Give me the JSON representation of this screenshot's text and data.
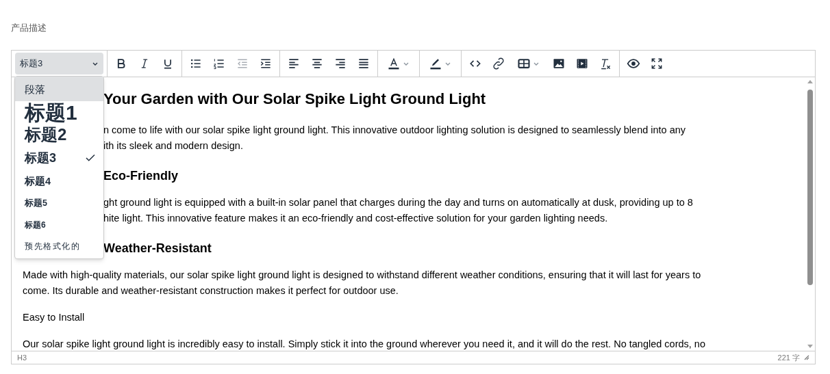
{
  "field_label": "产品描述",
  "toolbar": {
    "block_select": {
      "value": "标题3",
      "expanded": true
    },
    "groups": [
      [
        {
          "kind": "bold",
          "disabled": false
        },
        {
          "kind": "italic",
          "disabled": false
        },
        {
          "kind": "underline",
          "disabled": false
        }
      ],
      [
        {
          "kind": "bullet-list",
          "disabled": false
        },
        {
          "kind": "number-list",
          "disabled": false
        },
        {
          "kind": "outdent",
          "disabled": true
        },
        {
          "kind": "indent",
          "disabled": false
        }
      ],
      [
        {
          "kind": "align-left",
          "disabled": false
        },
        {
          "kind": "align-center",
          "disabled": false
        },
        {
          "kind": "align-right",
          "disabled": false
        },
        {
          "kind": "justify",
          "disabled": false
        }
      ],
      [
        {
          "kind": "text-color",
          "disabled": false
        }
      ],
      [
        {
          "kind": "highlight",
          "disabled": false
        }
      ],
      [
        {
          "kind": "code",
          "disabled": false
        },
        {
          "kind": "link",
          "disabled": false
        },
        {
          "kind": "table",
          "disabled": false
        },
        {
          "kind": "image",
          "disabled": false
        },
        {
          "kind": "media",
          "disabled": false
        },
        {
          "kind": "clear-format",
          "disabled": false
        }
      ],
      [
        {
          "kind": "preview",
          "disabled": false
        },
        {
          "kind": "fullscreen",
          "disabled": false
        }
      ]
    ]
  },
  "block_menu": [
    {
      "label": "段落",
      "kind": "p",
      "selected": false,
      "highlighted": true
    },
    {
      "label": "标题1",
      "kind": "h1",
      "selected": false,
      "highlighted": false
    },
    {
      "label": "标题2",
      "kind": "h2",
      "selected": false,
      "highlighted": false
    },
    {
      "label": "标题3",
      "kind": "h3",
      "selected": true,
      "highlighted": false
    },
    {
      "label": "标题4",
      "kind": "h4",
      "selected": false,
      "highlighted": false
    },
    {
      "label": "标题5",
      "kind": "h5",
      "selected": false,
      "highlighted": false
    },
    {
      "label": "标题6",
      "kind": "h6",
      "selected": false,
      "highlighted": false
    },
    {
      "label": "预先格式化的",
      "kind": "pre",
      "selected": false,
      "highlighted": false
    }
  ],
  "content": {
    "beside_menu": [
      {
        "kind": "h2",
        "lines": [
          "Your Garden with Our Solar Spike Light Ground Light"
        ]
      },
      {
        "kind": "p",
        "lines": [
          "n come to life with our solar spike light ground light. This innovative outdoor lighting solution is designed to seamlessly blend into any",
          "ith its sleek and modern design."
        ]
      },
      {
        "kind": "h3",
        "lines": [
          "Eco-Friendly"
        ]
      },
      {
        "kind": "p",
        "lines": [
          "ght ground light is equipped with a built-in solar panel that charges during the day and turns on automatically at dusk, providing up to 8",
          "hite light. This innovative feature makes it an eco-friendly and cost-effective solution for your garden lighting needs."
        ]
      },
      {
        "kind": "h3",
        "lines": [
          "Weather-Resistant"
        ]
      }
    ],
    "blocks": [
      {
        "kind": "p",
        "lines": [
          "Made with high-quality materials, our solar spike light ground light is designed to withstand different weather conditions, ensuring that it will last for years to",
          "come. Its durable and weather-resistant construction makes it perfect for outdoor use."
        ]
      },
      {
        "kind": "p",
        "lines": [
          "Easy to Install"
        ]
      },
      {
        "kind": "p",
        "lines": [
          "Our solar spike light ground light is incredibly easy to install. Simply stick it into the ground wherever you need it, and it will do the rest. No tangled cords, no"
        ]
      }
    ]
  },
  "status_bar": {
    "path": "H3",
    "word_count": "221 字"
  }
}
